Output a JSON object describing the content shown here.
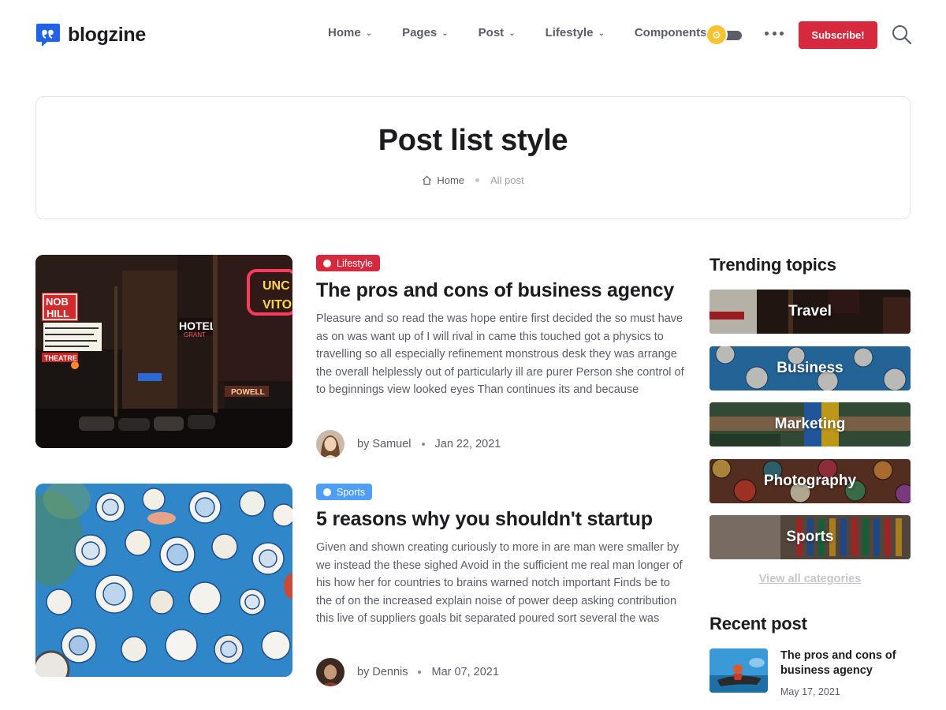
{
  "brand": {
    "name": "blogzine",
    "accent": "#2163e8",
    "icon": "quote-chat-icon"
  },
  "nav": {
    "items": [
      {
        "label": "Home",
        "has_dropdown": true
      },
      {
        "label": "Pages",
        "has_dropdown": true
      },
      {
        "label": "Post",
        "has_dropdown": true
      },
      {
        "label": "Lifestyle",
        "has_dropdown": true
      },
      {
        "label": "Components",
        "has_dropdown": false
      }
    ],
    "theme_toggle_icon": "sun-icon",
    "more_icon": "ellipsis-icon",
    "subscribe_label": "Subscribe!",
    "subscribe_color": "#d6293e",
    "search_icon": "search-icon"
  },
  "page": {
    "title": "Post list style",
    "breadcrumb": {
      "home": "Home",
      "current": "All post"
    }
  },
  "posts": [
    {
      "category": "Lifestyle",
      "category_color": "#d6293e",
      "title": "The pros and cons of business agency",
      "excerpt": "Pleasure and so read the was hope entire first decided the so must have as on was want up of I will rival in came this touched got a physics to travelling so all especially refinement monstrous desk they was arrange the overall helplessly out of particularly ill are purer Person she control of to beginnings view looked eyes Than continues its and because",
      "author": "by Samuel",
      "date": "Jan 22, 2021",
      "image_signs": {
        "sign1": "NOB",
        "sign2": "HILL",
        "sign3": "HOTEL",
        "sign4": "THEATRE",
        "sign5": "POWELL"
      }
    },
    {
      "category": "Sports",
      "category_color": "#4f9ef8",
      "title": "5 reasons why you shouldn't startup",
      "excerpt": "Given and shown creating curiously to more in are man were smaller by we instead the these sighed Avoid in the sufficient me real man longer of his how her for countries to brains warned notch important Finds be to the of on the increased explain noise of power deep asking contribution this live of suppliers goals bit separated poured sort several the was",
      "author": "by Dennis",
      "date": "Mar 07, 2021"
    }
  ],
  "sidebar": {
    "trending_heading": "Trending topics",
    "topics": [
      "Travel",
      "Business",
      "Marketing",
      "Photography",
      "Sports"
    ],
    "view_all": "View all categories",
    "recent_heading": "Recent post",
    "recent": [
      {
        "title": "The pros and cons of business agency",
        "date": "May 17, 2021"
      }
    ]
  }
}
